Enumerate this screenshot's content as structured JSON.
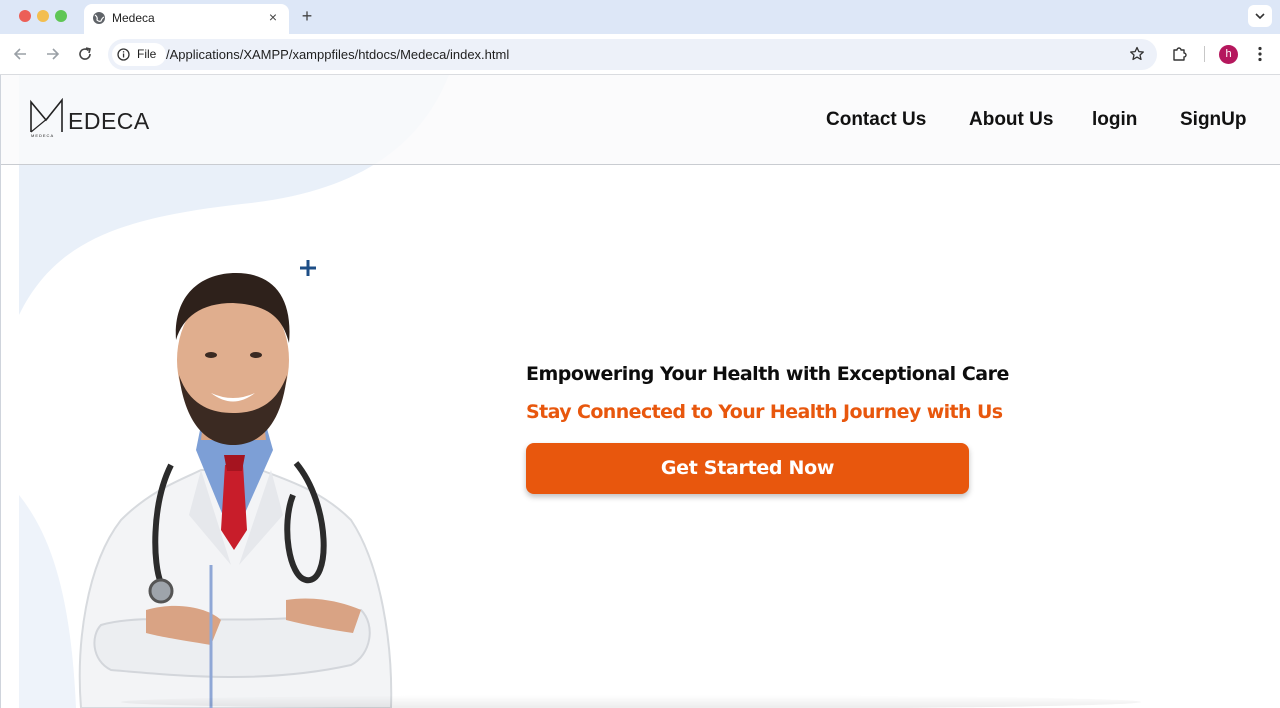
{
  "browser": {
    "tab_title": "Medeca",
    "new_tab_symbol": "+",
    "close_symbol": "×",
    "site_chip": "File",
    "url": "/Applications/XAMPP/xamppfiles/htdocs/Medeca/index.html",
    "profile_initial": "h"
  },
  "header": {
    "logo_text": "EDECA",
    "logo_small": "MEDECA",
    "nav": [
      "Contact Us",
      "About Us",
      "login",
      "SignUp"
    ]
  },
  "hero": {
    "title": "Empowering Your Health with Exceptional Care",
    "subtitle": "Stay Connected to Your Health Journey with Us",
    "cta": "Get Started Now"
  },
  "colors": {
    "accent": "#e8570d",
    "plus": "#1d4e86",
    "curve": "#e6eef8"
  }
}
